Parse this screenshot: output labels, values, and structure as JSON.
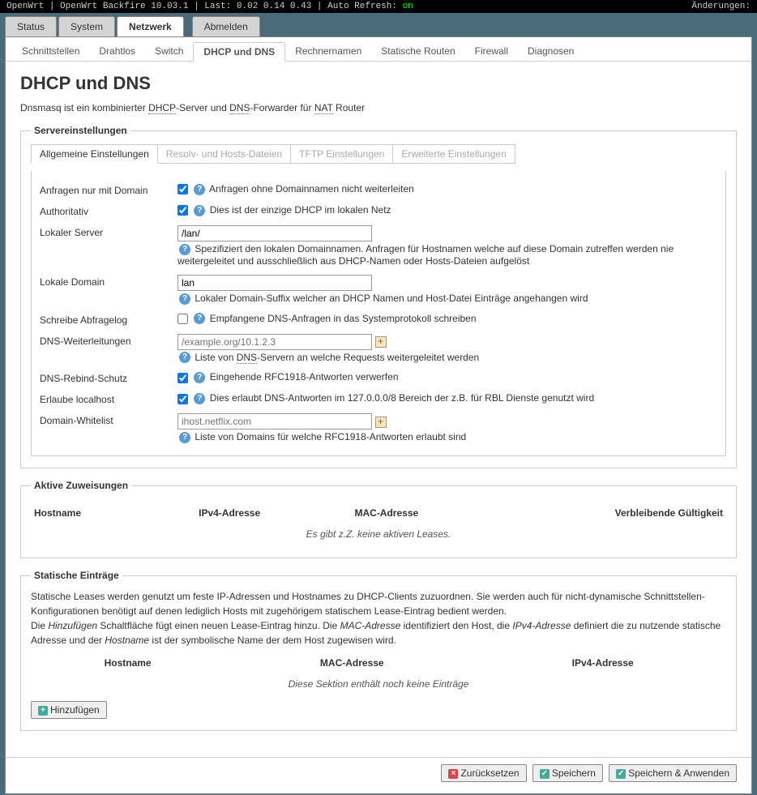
{
  "topbar": {
    "brand": "OpenWrt",
    "version": "OpenWrt Backfire 10.03.1",
    "load_label": "Last:",
    "load": "0.02 0.14 0.43",
    "refresh_label": "Auto Refresh:",
    "refresh_state": "on",
    "changes_label": "Änderungen:"
  },
  "tabs1": {
    "status": "Status",
    "system": "System",
    "network": "Netzwerk",
    "logout": "Abmelden"
  },
  "tabs2": {
    "interfaces": "Schnittstellen",
    "wireless": "Drahtlos",
    "switch": "Switch",
    "dhcp": "DHCP und DNS",
    "hostnames": "Rechnernamen",
    "routes": "Statische Routen",
    "firewall": "Firewall",
    "diag": "Diagnosen"
  },
  "page": {
    "title": "DHCP und DNS",
    "desc_1": "Dnsmasq ist ein kombinierter ",
    "desc_abbr1": "DHCP",
    "desc_2": "-Server und ",
    "desc_abbr2": "DNS",
    "desc_3": "-Forwarder für ",
    "desc_abbr3": "NAT",
    "desc_4": " Router"
  },
  "server": {
    "legend": "Servereinstellungen",
    "subtabs": {
      "general": "Allgemeine Einstellungen",
      "resolv": "Resolv- und Hosts-Dateien",
      "tftp": "TFTP Einstellungen",
      "advanced": "Erweiterte Einstellungen"
    },
    "rows": {
      "domainneeded": {
        "label": "Anfragen nur mit Domain",
        "hint": "Anfragen ohne Domainnamen nicht weiterleiten"
      },
      "authoritative": {
        "label": "Authoritativ",
        "hint": "Dies ist der einzige DHCP im lokalen Netz"
      },
      "localserver": {
        "label": "Lokaler Server",
        "value": "/lan/",
        "hint": "Spezifiziert den lokalen Domainnamen. Anfragen für Hostnamen welche auf diese Domain zutreffen werden nie weitergeleitet und ausschließlich aus DHCP-Namen oder Hosts-Dateien aufgelöst"
      },
      "localdomain": {
        "label": "Lokale Domain",
        "value": "lan",
        "hint": "Lokaler Domain-Suffix welcher an DHCP Namen und Host-Datei Einträge angehangen wird"
      },
      "logqueries": {
        "label": "Schreibe Abfragelog",
        "hint": "Empfangene DNS-Anfragen in das Systemprotokoll schreiben"
      },
      "dnsforward": {
        "label": "DNS-Weiterleitungen",
        "placeholder": "/example.org/10.1.2.3",
        "hint_1": "Liste von ",
        "hint_abbr": "DNS",
        "hint_2": "-Servern an welche Requests weitergeleitet werden"
      },
      "rebind": {
        "label": "DNS-Rebind-Schutz",
        "hint": "Eingehende RFC1918-Antworten verwerfen"
      },
      "localhost": {
        "label": "Erlaube localhost",
        "hint": "Dies erlaubt DNS-Antworten im 127.0.0.0/8 Bereich der z.B. für RBL Dienste genutzt wird"
      },
      "whitelist": {
        "label": "Domain-Whitelist",
        "placeholder": "ihost.netflix.com",
        "hint": "Liste von Domains für welche RFC1918-Antworten erlaubt sind"
      }
    }
  },
  "active": {
    "legend": "Aktive Zuweisungen",
    "th_host": "Hostname",
    "th_ipv4": "IPv4-Adresse",
    "th_mac": "MAC-Adresse",
    "th_remain": "Verbleibende Gültigkeit",
    "empty": "Es gibt z.Z. keine aktiven Leases."
  },
  "static": {
    "legend": "Statische Einträge",
    "desc_1": "Statische Leases werden genutzt um feste IP-Adressen und Hostnames zu DHCP-Clients zuzuordnen. Sie werden auch für nicht-dynamische Schnittstellen-Konfigurationen benötigt auf denen lediglich Hosts mit zugehörigem statischem Lease-Eintrag bedient werden.",
    "desc_2a": "Die ",
    "desc_2b": "Hinzufügen",
    "desc_2c": " Schaltfläche fügt einen neuen Lease-Eintrag hinzu. Die ",
    "desc_2d": "MAC-Adresse",
    "desc_2e": " identifiziert den Host, die ",
    "desc_2f": "IPv4-Adresse",
    "desc_2g": " definiert die zu nutzende statische Adresse und der ",
    "desc_2h": "Hostname",
    "desc_2i": " ist der symbolische Name der dem Host zugewisen wird.",
    "th_host": "Hostname",
    "th_mac": "MAC-Adresse",
    "th_ipv4": "IPv4-Adresse",
    "empty": "Diese Sektion enthält noch keine Einträge",
    "add": "Hinzufügen"
  },
  "actions": {
    "reset": "Zurücksetzen",
    "save": "Speichern",
    "apply": "Speichern & Anwenden"
  }
}
